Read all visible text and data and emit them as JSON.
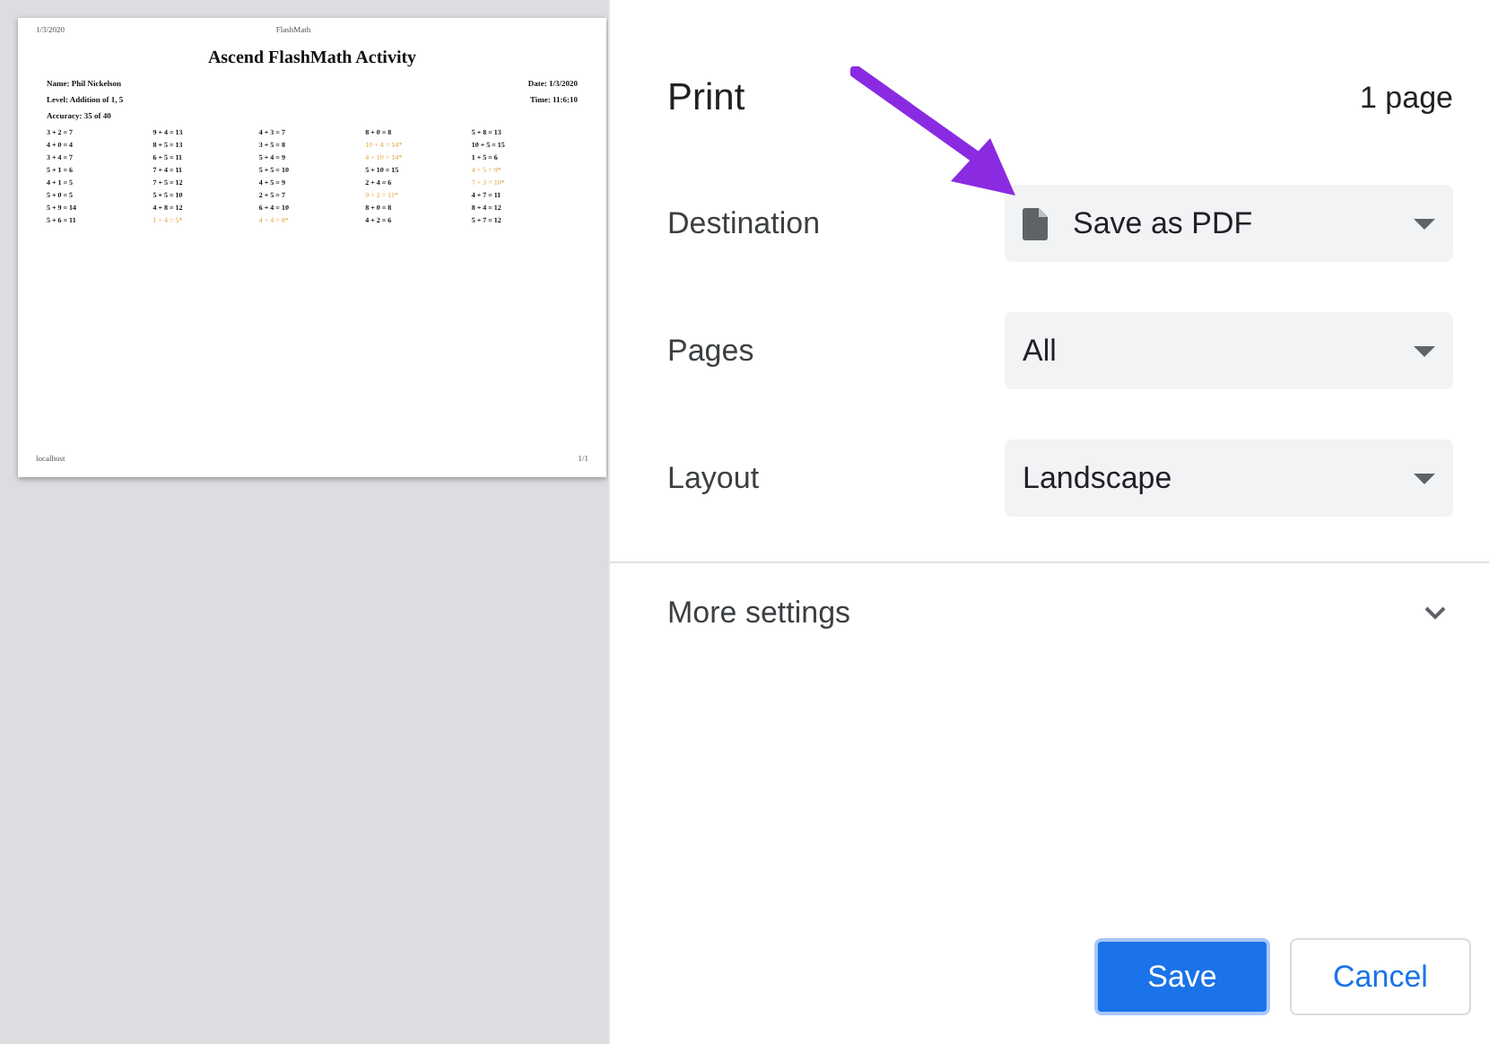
{
  "preview": {
    "header_left": "1/3/2020",
    "header_center": "FlashMath",
    "title": "Ascend FlashMath Activity",
    "name": "Name: Phil Nickelson",
    "date": "Date: 1/3/2020",
    "level": "Level: Addition of 1, 5",
    "time": "Time: 11:6:10",
    "accuracy": "Accuracy: 35 of 40",
    "problems": [
      [
        {
          "text": "3 + 2 = 7",
          "wrong": false
        },
        {
          "text": "4 + 0 = 4",
          "wrong": false
        },
        {
          "text": "3 + 4 = 7",
          "wrong": false
        },
        {
          "text": "5 + 1 = 6",
          "wrong": false
        },
        {
          "text": "4 + 1 = 5",
          "wrong": false
        },
        {
          "text": "5 + 0 = 5",
          "wrong": false
        },
        {
          "text": "5 + 9 = 14",
          "wrong": false
        },
        {
          "text": "5 + 6 = 11",
          "wrong": false
        }
      ],
      [
        {
          "text": "9 + 4 = 13",
          "wrong": false
        },
        {
          "text": "8 + 5 = 13",
          "wrong": false
        },
        {
          "text": "6 + 5 = 11",
          "wrong": false
        },
        {
          "text": "7 + 4 = 11",
          "wrong": false
        },
        {
          "text": "7 + 5 = 12",
          "wrong": false
        },
        {
          "text": "5 + 5 = 10",
          "wrong": false
        },
        {
          "text": "4 + 8 = 12",
          "wrong": false
        },
        {
          "text": "1 + 4 = 5*",
          "wrong": true
        }
      ],
      [
        {
          "text": "4 + 3 = 7",
          "wrong": false
        },
        {
          "text": "3 + 5 = 8",
          "wrong": false
        },
        {
          "text": "5 + 4 = 9",
          "wrong": false
        },
        {
          "text": "5 + 5 = 10",
          "wrong": false
        },
        {
          "text": "4 + 5 = 9",
          "wrong": false
        },
        {
          "text": "2 + 5 = 7",
          "wrong": false
        },
        {
          "text": "6 + 4 = 10",
          "wrong": false
        },
        {
          "text": "4 + 4 = 8*",
          "wrong": true
        }
      ],
      [
        {
          "text": "8 + 0 = 8",
          "wrong": false
        },
        {
          "text": "10 + 4 = 14*",
          "wrong": true
        },
        {
          "text": "4 + 10 = 14*",
          "wrong": true
        },
        {
          "text": "5 + 10 = 15",
          "wrong": false
        },
        {
          "text": "2 + 4 = 6",
          "wrong": false
        },
        {
          "text": "9 + 2 = 11*",
          "wrong": true
        },
        {
          "text": "8 + 0 = 8",
          "wrong": false
        },
        {
          "text": "4 + 2 = 6",
          "wrong": false
        }
      ],
      [
        {
          "text": "5 + 8 = 13",
          "wrong": false
        },
        {
          "text": "10 + 5 = 15",
          "wrong": false
        },
        {
          "text": "1 + 5 = 6",
          "wrong": false
        },
        {
          "text": "4 + 5 = 9*",
          "wrong": true
        },
        {
          "text": "7 + 3 = 10*",
          "wrong": true
        },
        {
          "text": "4 + 7 = 11",
          "wrong": false
        },
        {
          "text": "8 + 4 = 12",
          "wrong": false
        },
        {
          "text": "5 + 7 = 12",
          "wrong": false
        }
      ]
    ],
    "footer_left": "localhost",
    "footer_right": "1/1"
  },
  "panel": {
    "title": "Print",
    "page_count": "1 page",
    "settings": [
      {
        "label": "Destination",
        "value": "Save as PDF",
        "kind": "document"
      },
      {
        "label": "Pages",
        "value": "All",
        "kind": "plain"
      },
      {
        "label": "Layout",
        "value": "Landscape",
        "kind": "plain"
      }
    ],
    "more_settings": {
      "label": "More settings",
      "expanded": false
    },
    "buttons": [
      {
        "label": "Save",
        "kind": "primary"
      },
      {
        "label": "Cancel",
        "kind": "secondary"
      }
    ]
  }
}
